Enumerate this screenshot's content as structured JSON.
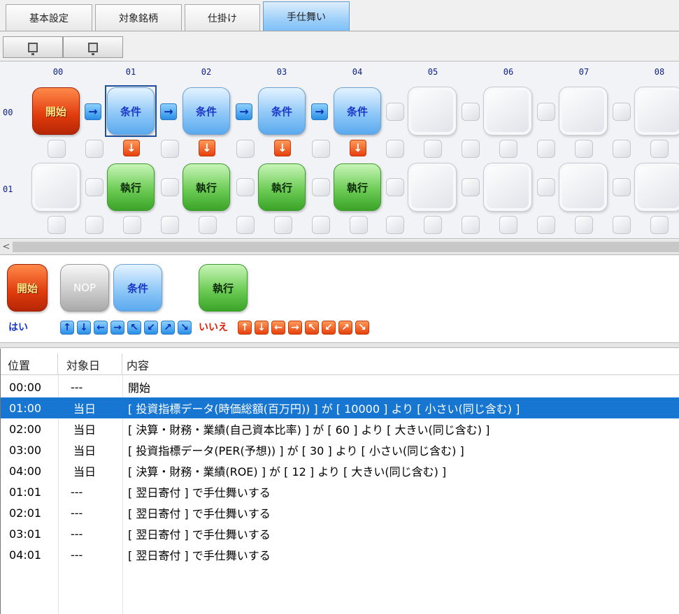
{
  "tabs": [
    {
      "label": "基本設定",
      "active": false
    },
    {
      "label": "対象銘柄",
      "active": false
    },
    {
      "label": "仕掛け",
      "active": false
    },
    {
      "label": "手仕舞い",
      "active": true
    }
  ],
  "toolbar": {
    "buttons": [
      {
        "icon": "monitor-icon"
      },
      {
        "icon": "monitor-icon"
      }
    ]
  },
  "grid": {
    "column_headers": [
      "00",
      "01",
      "02",
      "03",
      "04",
      "05",
      "06",
      "07",
      "08"
    ],
    "row_headers": [
      "00",
      "01"
    ],
    "row0_blocks": [
      {
        "col": "00",
        "label": "開始",
        "kind": "start"
      },
      {
        "col": "01",
        "label": "条件",
        "kind": "cond",
        "selected": true
      },
      {
        "col": "02",
        "label": "条件",
        "kind": "cond"
      },
      {
        "col": "03",
        "label": "条件",
        "kind": "cond"
      },
      {
        "col": "04",
        "label": "条件",
        "kind": "cond"
      }
    ],
    "row1_blocks": [
      {
        "col": "01",
        "label": "執行",
        "kind": "exec"
      },
      {
        "col": "02",
        "label": "執行",
        "kind": "exec"
      },
      {
        "col": "03",
        "label": "執行",
        "kind": "exec"
      },
      {
        "col": "04",
        "label": "執行",
        "kind": "exec"
      }
    ],
    "arrow_right": "→",
    "arrow_down": "↓"
  },
  "palette": {
    "blocks": [
      {
        "label": "開始",
        "kind": "start"
      },
      {
        "label": "NOP",
        "kind": "nop"
      },
      {
        "label": "条件",
        "kind": "cond"
      },
      {
        "label": "執行",
        "kind": "exec"
      }
    ],
    "yes_label": "はい",
    "no_label": "いいえ",
    "yes_arrows": [
      "↑",
      "↓",
      "←",
      "→",
      "↖",
      "↙",
      "↗",
      "↘"
    ],
    "no_arrows": [
      "↑",
      "↓",
      "←",
      "→",
      "↖",
      "↙",
      "↗",
      "↘"
    ]
  },
  "scrollbar": {
    "left_arrow": "<"
  },
  "table": {
    "headers": [
      "位置",
      "対象日",
      "内容"
    ],
    "rows": [
      {
        "pos": "00:00",
        "day": "---",
        "content": "開始",
        "selected": false
      },
      {
        "pos": "01:00",
        "day": "当日",
        "content": "[ 投資指標データ(時価総額(百万円)) ] が [ 10000 ] より [ 小さい(同じ含む) ]",
        "selected": true
      },
      {
        "pos": "02:00",
        "day": "当日",
        "content": "[ 決算・財務・業績(自己資本比率) ] が [ 60 ] より [ 大きい(同じ含む) ]",
        "selected": false
      },
      {
        "pos": "03:00",
        "day": "当日",
        "content": "[ 投資指標データ(PER(予想)) ] が [ 30 ] より [ 小さい(同じ含む) ]",
        "selected": false
      },
      {
        "pos": "04:00",
        "day": "当日",
        "content": "[ 決算・財務・業績(ROE) ] が [ 12 ] より [ 大きい(同じ含む) ]",
        "selected": false
      },
      {
        "pos": "01:01",
        "day": "---",
        "content": "[ 翌日寄付 ] で手仕舞いする",
        "selected": false
      },
      {
        "pos": "02:01",
        "day": "---",
        "content": "[ 翌日寄付 ] で手仕舞いする",
        "selected": false
      },
      {
        "pos": "03:01",
        "day": "---",
        "content": "[ 翌日寄付 ] で手仕舞いする",
        "selected": false
      },
      {
        "pos": "04:01",
        "day": "---",
        "content": "[ 翌日寄付 ] で手仕舞いする",
        "selected": false
      }
    ]
  },
  "colors": {
    "selection": "#1676d2",
    "header_text": "#0b1e8a"
  }
}
